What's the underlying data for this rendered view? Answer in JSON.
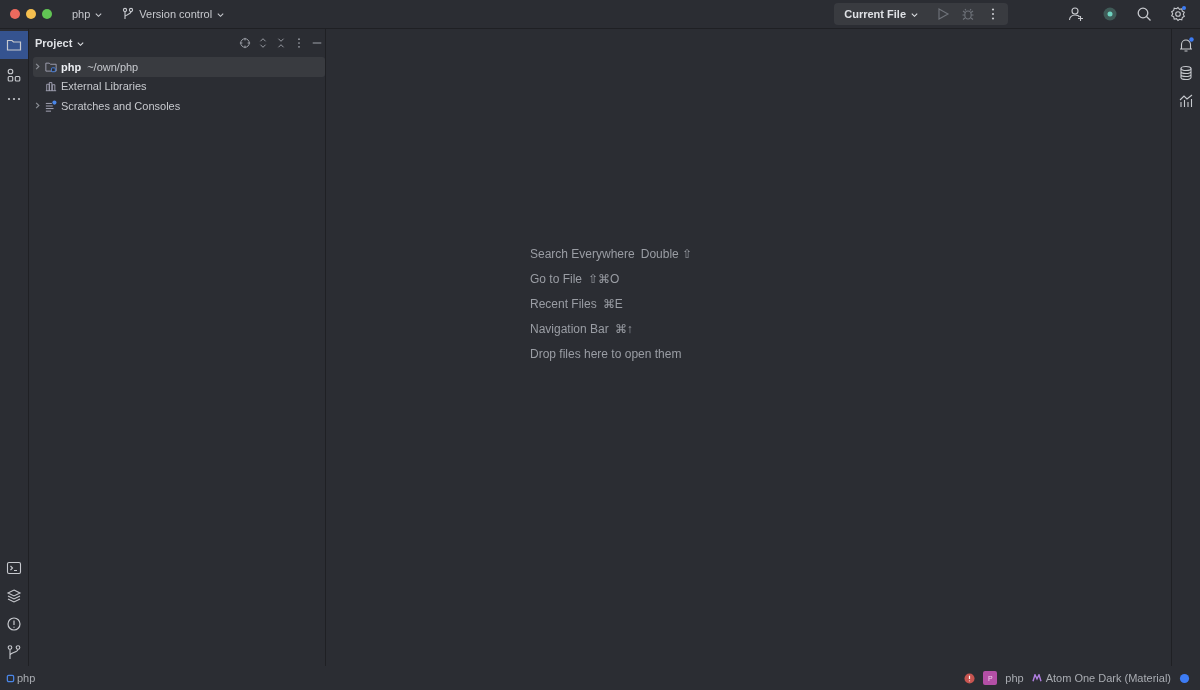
{
  "title_bar": {
    "project": "php",
    "vcs": "Version control",
    "run_config": "Current File"
  },
  "project_panel": {
    "title": "Project",
    "tree": [
      {
        "kind": "folder",
        "name": "php",
        "path": "~/own/php",
        "expanded": false,
        "selected": true
      },
      {
        "kind": "library",
        "name": "External Libraries",
        "selected": false
      },
      {
        "kind": "scratches",
        "name": "Scratches and Consoles",
        "expanded": false,
        "selected": false
      }
    ]
  },
  "hints": [
    {
      "label": "Search Everywhere",
      "shortcut": "Double ⇧"
    },
    {
      "label": "Go to File",
      "shortcut": "⇧⌘O"
    },
    {
      "label": "Recent Files",
      "shortcut": "⌘E"
    },
    {
      "label": "Navigation Bar",
      "shortcut": "⌘↑"
    },
    {
      "label": "Drop files here to open them"
    }
  ],
  "status_bar": {
    "breadcrumb": "php",
    "file_badge": "P",
    "language": "php",
    "theme": "Atom One Dark (Material)"
  }
}
